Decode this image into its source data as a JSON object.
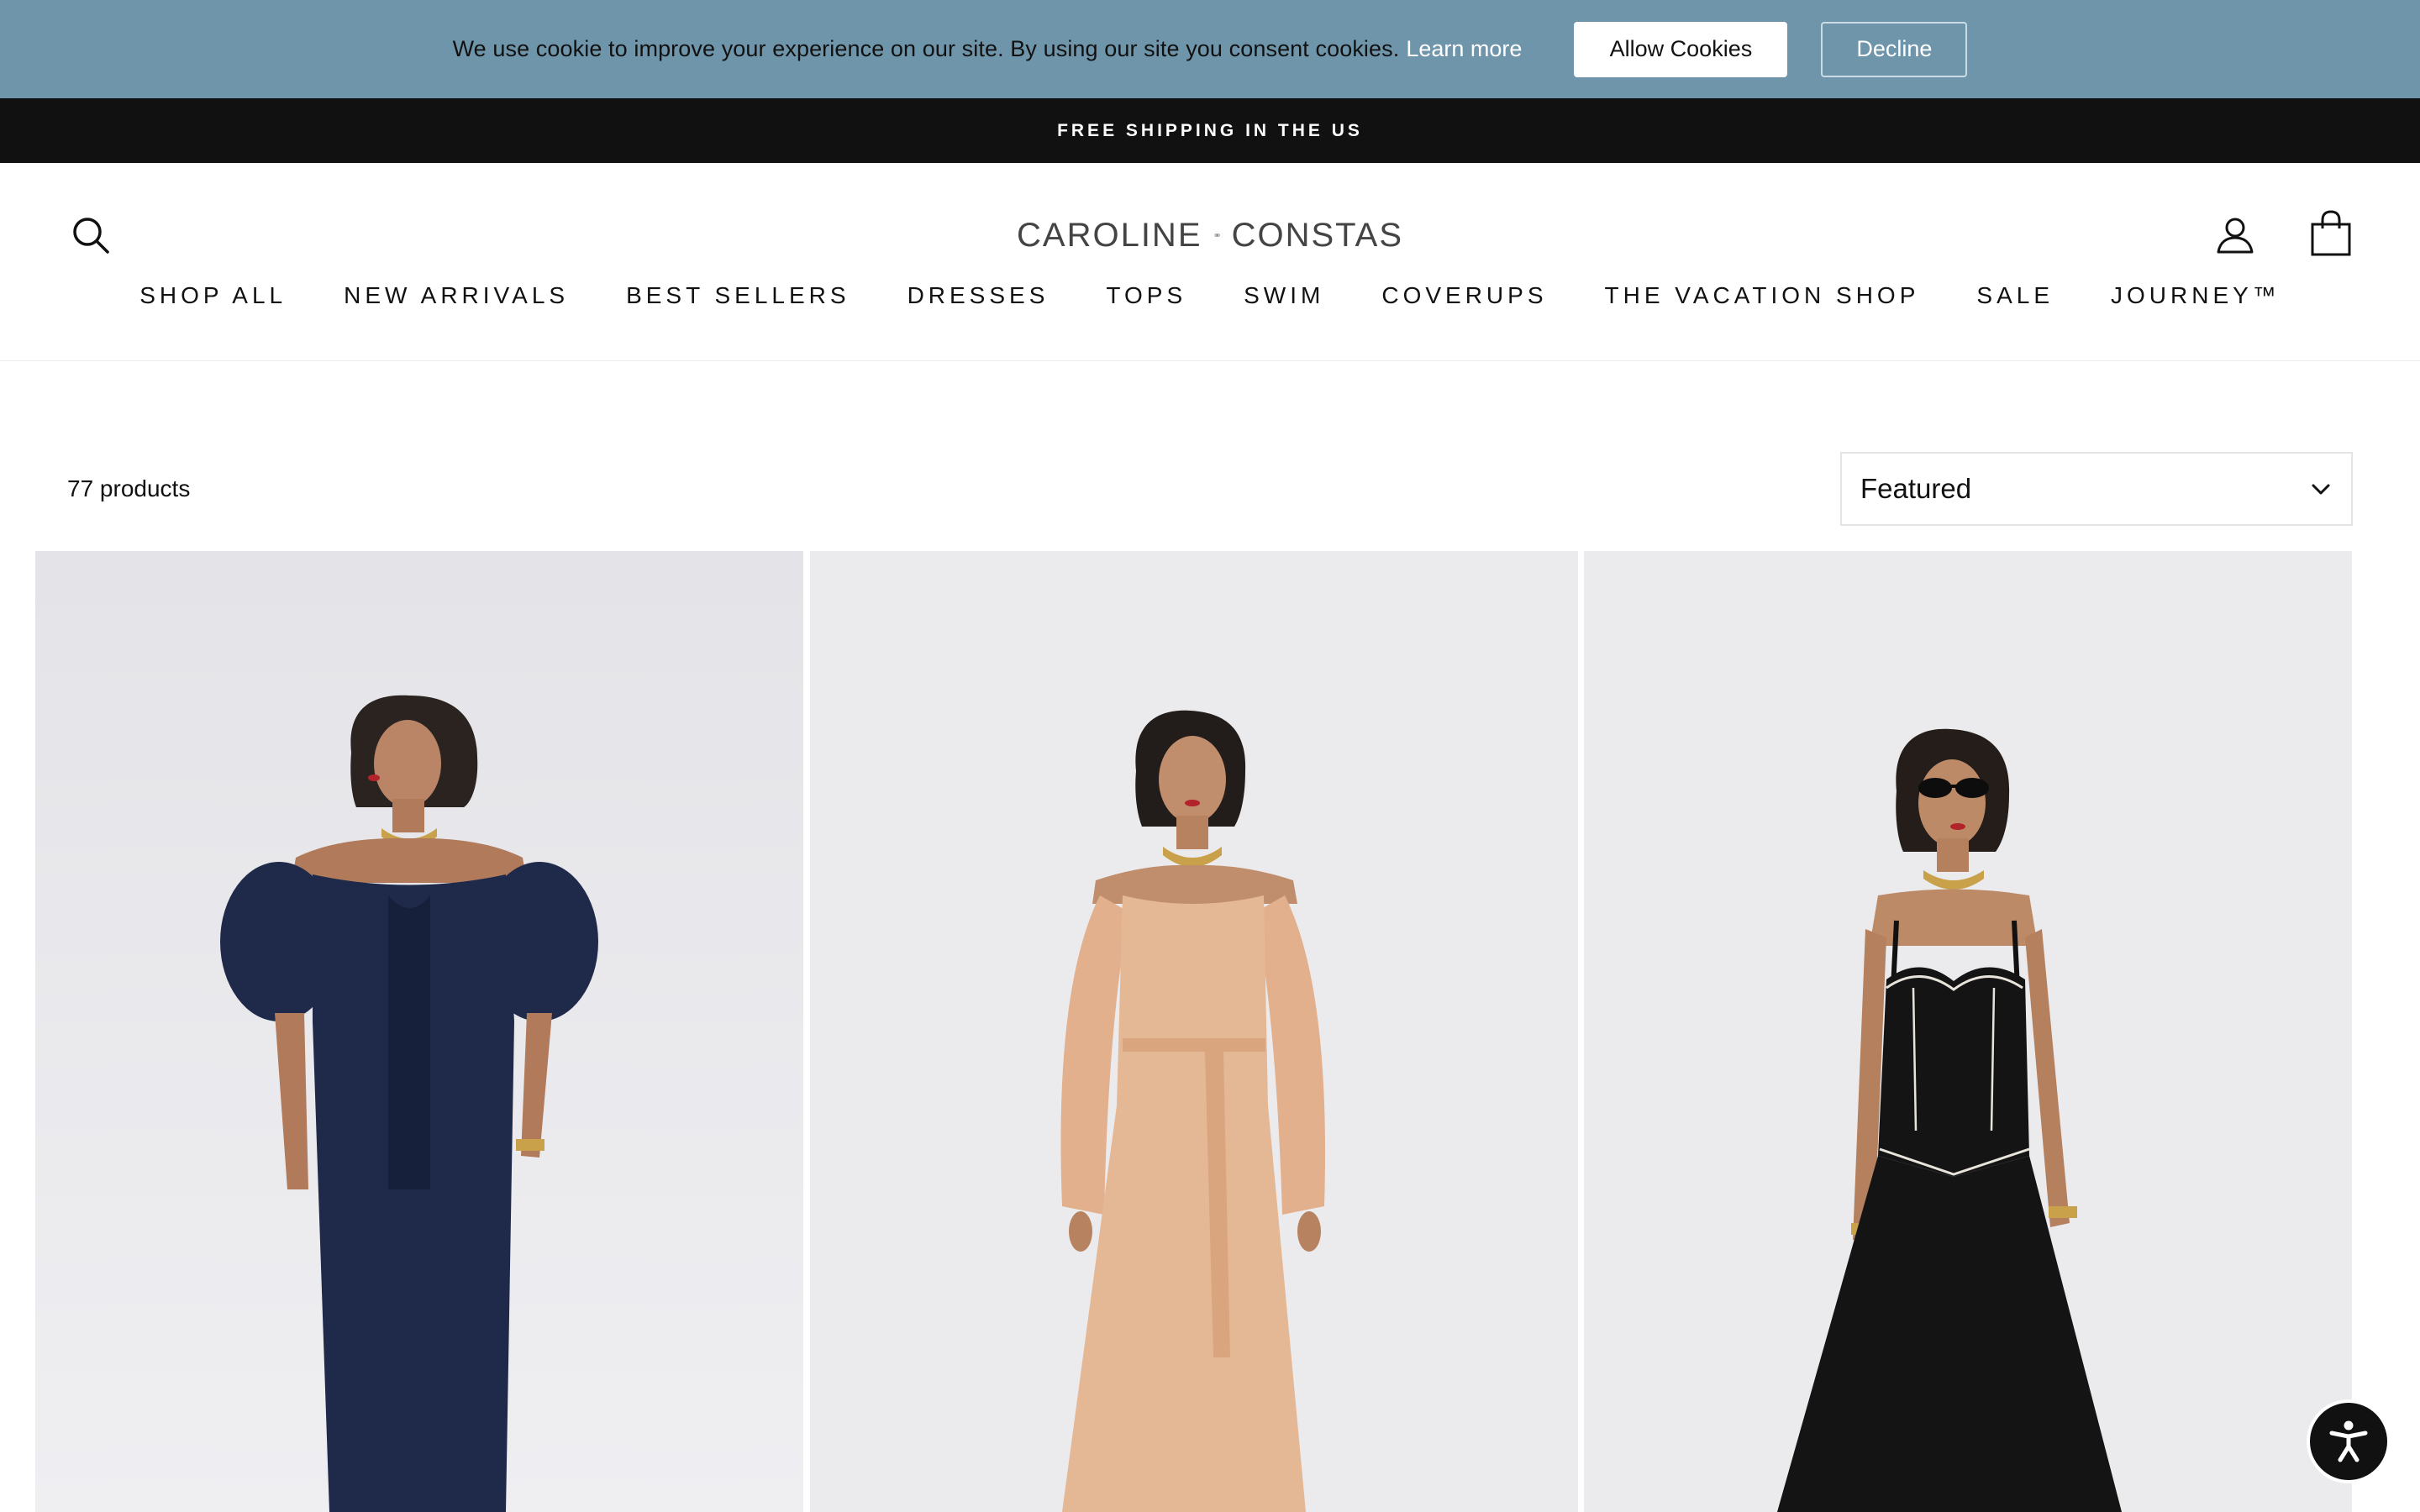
{
  "cookie_banner": {
    "message": "We use cookie to improve your experience on our site. By using our site you consent cookies.",
    "learn_more": "Learn more",
    "allow_label": "Allow Cookies",
    "decline_label": "Decline",
    "background_color": "#6f95aa"
  },
  "announcement": {
    "text": "FREE SHIPPING IN THE US"
  },
  "header": {
    "logo_left": "CAROLINE",
    "logo_right": "CONSTAS",
    "icons": {
      "search": "search-icon",
      "account": "user-icon",
      "cart": "shopping-bag-icon"
    }
  },
  "nav": {
    "items": [
      "SHOP ALL",
      "NEW ARRIVALS",
      "BEST SELLERS",
      "DRESSES",
      "TOPS",
      "SWIM",
      "COVERUPS",
      "THE VACATION SHOP",
      "SALE",
      "JOURNEY™"
    ]
  },
  "collection": {
    "product_count": "77 products",
    "sort": {
      "selected": "Featured"
    }
  },
  "products": [
    {
      "image": "model-navy-off-shoulder-dress",
      "color": "#1f2a4a"
    },
    {
      "image": "model-peach-off-shoulder-gown",
      "color": "#e5b895"
    },
    {
      "image": "model-black-bustier-dress",
      "color": "#141414"
    }
  ],
  "accessibility": {
    "icon": "accessibility-icon"
  }
}
